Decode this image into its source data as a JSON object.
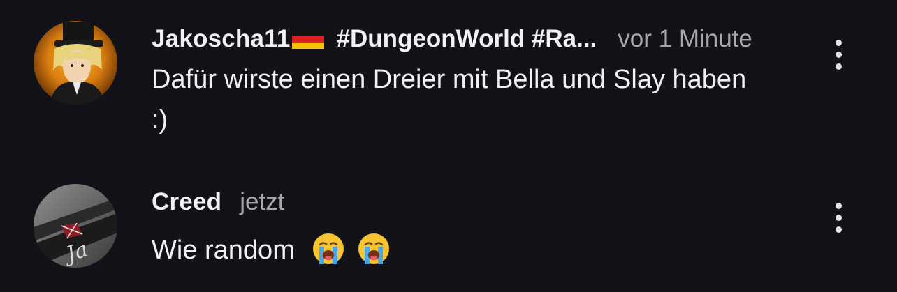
{
  "comments": [
    {
      "author": "Jakoscha11",
      "author_flag": "germany-flag",
      "tags": "#DungeonWorld #Ra...",
      "time": "vor 1 Minute",
      "text": "Dafür wirste einen Dreier mit Bella und Slay haben :)"
    },
    {
      "author": "Creed",
      "time": "jetzt",
      "text": "Wie random",
      "emojis": [
        "loudly-crying-face",
        "loudly-crying-face"
      ]
    }
  ],
  "colors": {
    "background": "#131218",
    "primary_text": "#f1f1f1",
    "secondary_text": "#a7a7ae",
    "menu_dots": "#e4e4e4"
  },
  "icons": {
    "menu": "vertical-dots-icon"
  }
}
